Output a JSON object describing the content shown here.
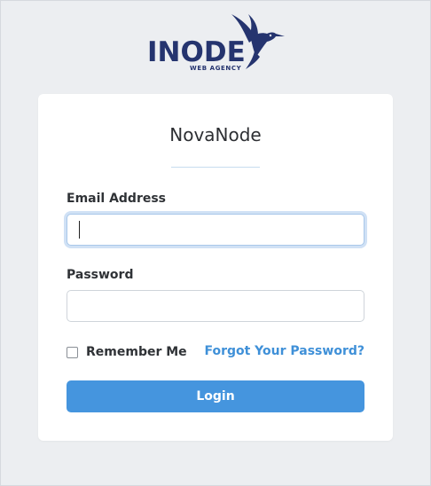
{
  "logo": {
    "name": "INODE",
    "tagline": "WEB AGENCY",
    "brand_color": "#25346f",
    "icon": "hummingbird-icon"
  },
  "card": {
    "title": "NovaNode"
  },
  "form": {
    "email_label": "Email Address",
    "email_value": "",
    "password_label": "Password",
    "password_value": "",
    "remember_label": "Remember Me",
    "remember_checked": false,
    "forgot_link": "Forgot Your Password?",
    "login_button": "Login"
  },
  "colors": {
    "accent": "#4595de",
    "link": "#3f90d8",
    "background": "#eceef1"
  }
}
